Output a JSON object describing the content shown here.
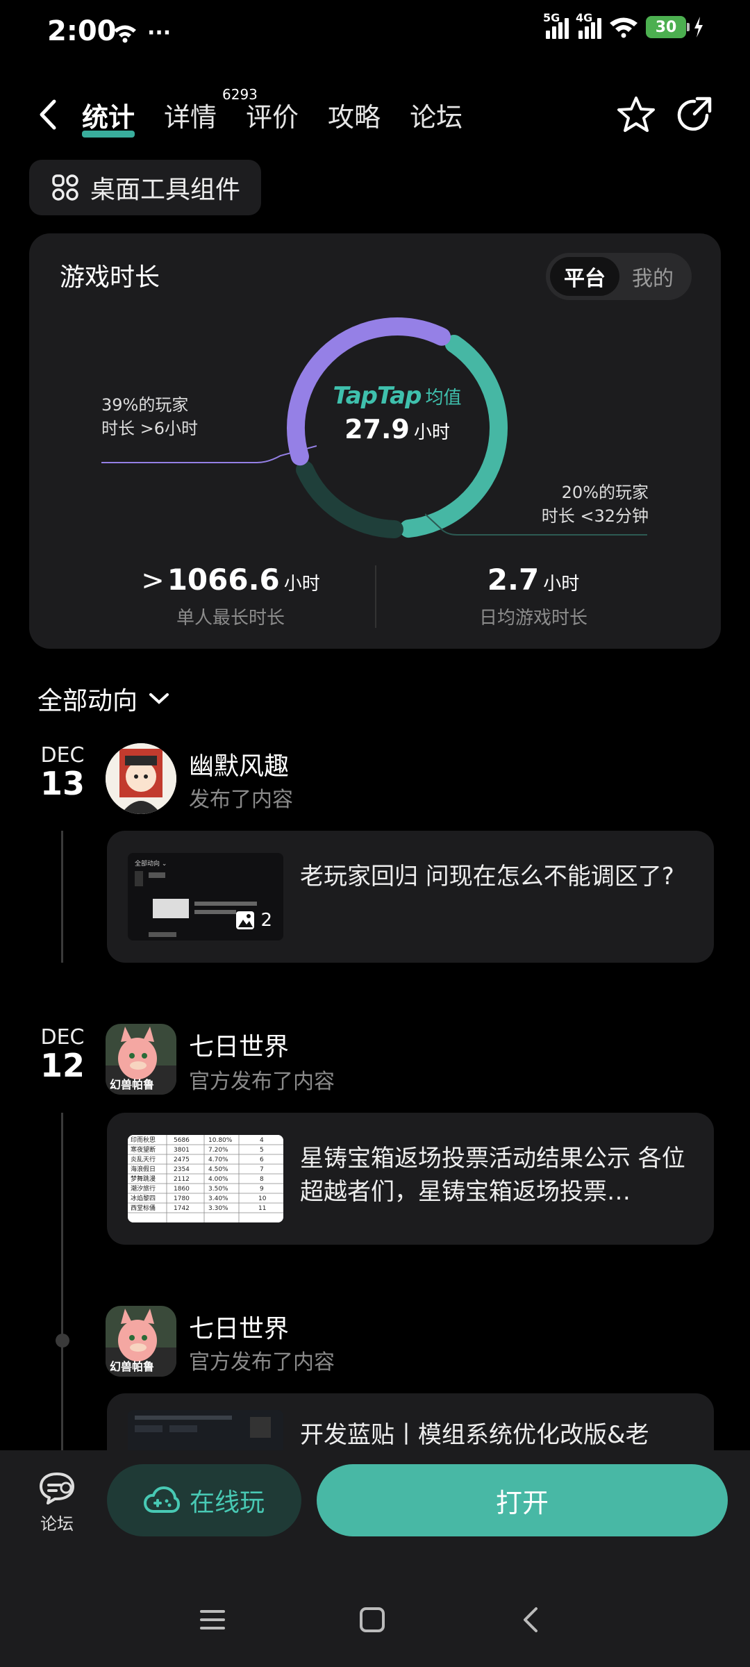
{
  "status_bar": {
    "time": "2:00",
    "dots": "···",
    "net1": "5G",
    "net2": "4G",
    "battery": "30"
  },
  "nav": {
    "tabs": [
      "统计",
      "详情",
      "评价",
      "攻略",
      "论坛"
    ],
    "active_index": 0,
    "review_count": "6293"
  },
  "widget_button": "桌面工具组件",
  "stats": {
    "title": "游戏时长",
    "toggle": [
      "平台",
      "我的"
    ],
    "brand": "TapTap",
    "brand_suffix": "均值",
    "avg_value": "27.9",
    "avg_unit": "小时",
    "note_left_line1": "39%的玩家",
    "note_left_line2": "时长 >6小时",
    "note_right_line1": "20%的玩家",
    "note_right_line2": "时长 <32分钟",
    "max_prefix": ">",
    "max_value": "1066.6",
    "max_unit": "小时",
    "max_label": "单人最长时长",
    "daily_value": "2.7",
    "daily_unit": "小时",
    "daily_label": "日均游戏时长",
    "ring_segments": [
      {
        "name": "long",
        "percent": 39,
        "color": "#9580e6"
      },
      {
        "name": "mid",
        "percent": 41,
        "color": "#46b7a4"
      },
      {
        "name": "short",
        "percent": 20,
        "color": "#1f3f3a"
      }
    ]
  },
  "feed": {
    "header": "全部动向",
    "items": [
      {
        "month": "DEC",
        "day": "13",
        "author": "幽默风趣",
        "action": "发布了内容",
        "text": "老玩家回归 问现在怎么不能调区了?",
        "image_count": "2"
      },
      {
        "month": "DEC",
        "day": "12",
        "author": "七日世界",
        "action": "官方发布了内容",
        "text": "星铸宝箱返场投票活动结果公示 各位超越者们，星铸宝箱返场投票…",
        "avatar_caption": "幻兽帕鲁"
      },
      {
        "author": "七日世界",
        "action": "官方发布了内容",
        "text": "开发蓝贴丨模组系统优化改版&老",
        "avatar_caption": "幻兽帕鲁"
      }
    ]
  },
  "bottom": {
    "forum": "论坛",
    "online": "在线玩",
    "open": "打开"
  },
  "colors": {
    "accent": "#48b8a5",
    "purple": "#9580e6"
  }
}
